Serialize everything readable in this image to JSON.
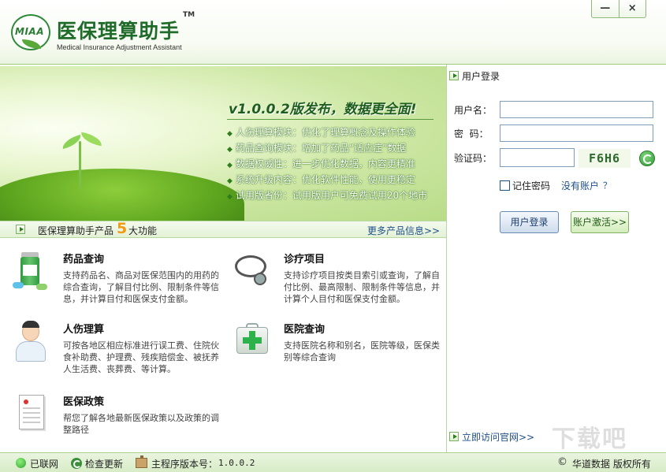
{
  "header": {
    "logo_text": "MIAA",
    "title": "医保理算助手",
    "tm": "TM",
    "subtitle": "Medical Insurance Adjustment Assistant",
    "minimize_label": "—",
    "close_label": "×"
  },
  "banner": {
    "headline": "v1.0.0.2版发布，数据更全面!",
    "items": [
      "人伤理算模块：优化了理算概念及操作体验",
      "药品查询模块：增加了药品“适应症”数据",
      "数据权威性：进一步优化数据，内容更精准",
      "系统升级内容：优化软件性能，使用更稳定",
      "试用版省份：试用版用户可免费试用20个地市"
    ]
  },
  "products": {
    "title": "医保理算助手产品",
    "count": "5",
    "suffix": "大功能",
    "more": "更多产品信息>>"
  },
  "features": [
    {
      "title": "药品查询",
      "icon": "medicine-bottle-icon",
      "desc": "支持药品名、商品对医保范围内的用药的综合查询，了解目付比例、限制条件等信息，并计算目付和医保支付金额。"
    },
    {
      "title": "诊疗项目",
      "icon": "stethoscope-icon",
      "desc": "支持诊疗项目按类目索引或查询，了解自付比例、最高限制、限制条件等信息，并计算个人目付和医保支付金额。"
    },
    {
      "title": "人伤理算",
      "icon": "doctor-icon",
      "desc": "可按各地区相应标准进行误工费、住院伙食补助费、护理费、残疾赔偿金、被抚养人生活费、丧葬费、等计算。"
    },
    {
      "title": "医院查询",
      "icon": "first-aid-kit-icon",
      "desc": "支持医院名称和别名，医院等级，医保类别等综合查询"
    },
    {
      "title": "医保政策",
      "icon": "policy-document-icon",
      "desc": "帮您了解各地最新医保政策以及政策的调整路径"
    }
  ],
  "login": {
    "heading": "用户登录",
    "username_label": "用户名：",
    "username_value": "",
    "password_label": "密  码：",
    "password_value": "",
    "captcha_label": "验证码：",
    "captcha_value": "",
    "captcha_code": "F6H6",
    "remember_label": "记住密码",
    "no_account": "没有账户",
    "help": "？",
    "login_button": "用户登录",
    "activate_button": "账户激活>>",
    "visit_site": "立即访问官网>>"
  },
  "statusbar": {
    "network": "已联网",
    "check_update": "检查更新",
    "version_label": "主程序版本号：",
    "version": "1.0.0.2",
    "copyright_symbol": "©",
    "copyright": "华道数据 版权所有"
  },
  "watermark": "下载吧",
  "colors": {
    "brand_green": "#1f6b2a",
    "accent_orange": "#f39a13",
    "link_blue": "#1e4f8a"
  }
}
